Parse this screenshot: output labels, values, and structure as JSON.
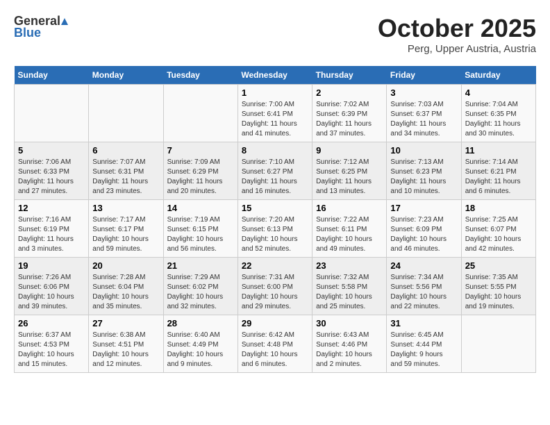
{
  "header": {
    "logo_general": "General",
    "logo_blue": "Blue",
    "month": "October 2025",
    "location": "Perg, Upper Austria, Austria"
  },
  "weekdays": [
    "Sunday",
    "Monday",
    "Tuesday",
    "Wednesday",
    "Thursday",
    "Friday",
    "Saturday"
  ],
  "weeks": [
    [
      {
        "day": "",
        "info": ""
      },
      {
        "day": "",
        "info": ""
      },
      {
        "day": "",
        "info": ""
      },
      {
        "day": "1",
        "info": "Sunrise: 7:00 AM\nSunset: 6:41 PM\nDaylight: 11 hours\nand 41 minutes."
      },
      {
        "day": "2",
        "info": "Sunrise: 7:02 AM\nSunset: 6:39 PM\nDaylight: 11 hours\nand 37 minutes."
      },
      {
        "day": "3",
        "info": "Sunrise: 7:03 AM\nSunset: 6:37 PM\nDaylight: 11 hours\nand 34 minutes."
      },
      {
        "day": "4",
        "info": "Sunrise: 7:04 AM\nSunset: 6:35 PM\nDaylight: 11 hours\nand 30 minutes."
      }
    ],
    [
      {
        "day": "5",
        "info": "Sunrise: 7:06 AM\nSunset: 6:33 PM\nDaylight: 11 hours\nand 27 minutes."
      },
      {
        "day": "6",
        "info": "Sunrise: 7:07 AM\nSunset: 6:31 PM\nDaylight: 11 hours\nand 23 minutes."
      },
      {
        "day": "7",
        "info": "Sunrise: 7:09 AM\nSunset: 6:29 PM\nDaylight: 11 hours\nand 20 minutes."
      },
      {
        "day": "8",
        "info": "Sunrise: 7:10 AM\nSunset: 6:27 PM\nDaylight: 11 hours\nand 16 minutes."
      },
      {
        "day": "9",
        "info": "Sunrise: 7:12 AM\nSunset: 6:25 PM\nDaylight: 11 hours\nand 13 minutes."
      },
      {
        "day": "10",
        "info": "Sunrise: 7:13 AM\nSunset: 6:23 PM\nDaylight: 11 hours\nand 10 minutes."
      },
      {
        "day": "11",
        "info": "Sunrise: 7:14 AM\nSunset: 6:21 PM\nDaylight: 11 hours\nand 6 minutes."
      }
    ],
    [
      {
        "day": "12",
        "info": "Sunrise: 7:16 AM\nSunset: 6:19 PM\nDaylight: 11 hours\nand 3 minutes."
      },
      {
        "day": "13",
        "info": "Sunrise: 7:17 AM\nSunset: 6:17 PM\nDaylight: 10 hours\nand 59 minutes."
      },
      {
        "day": "14",
        "info": "Sunrise: 7:19 AM\nSunset: 6:15 PM\nDaylight: 10 hours\nand 56 minutes."
      },
      {
        "day": "15",
        "info": "Sunrise: 7:20 AM\nSunset: 6:13 PM\nDaylight: 10 hours\nand 52 minutes."
      },
      {
        "day": "16",
        "info": "Sunrise: 7:22 AM\nSunset: 6:11 PM\nDaylight: 10 hours\nand 49 minutes."
      },
      {
        "day": "17",
        "info": "Sunrise: 7:23 AM\nSunset: 6:09 PM\nDaylight: 10 hours\nand 46 minutes."
      },
      {
        "day": "18",
        "info": "Sunrise: 7:25 AM\nSunset: 6:07 PM\nDaylight: 10 hours\nand 42 minutes."
      }
    ],
    [
      {
        "day": "19",
        "info": "Sunrise: 7:26 AM\nSunset: 6:06 PM\nDaylight: 10 hours\nand 39 minutes."
      },
      {
        "day": "20",
        "info": "Sunrise: 7:28 AM\nSunset: 6:04 PM\nDaylight: 10 hours\nand 35 minutes."
      },
      {
        "day": "21",
        "info": "Sunrise: 7:29 AM\nSunset: 6:02 PM\nDaylight: 10 hours\nand 32 minutes."
      },
      {
        "day": "22",
        "info": "Sunrise: 7:31 AM\nSunset: 6:00 PM\nDaylight: 10 hours\nand 29 minutes."
      },
      {
        "day": "23",
        "info": "Sunrise: 7:32 AM\nSunset: 5:58 PM\nDaylight: 10 hours\nand 25 minutes."
      },
      {
        "day": "24",
        "info": "Sunrise: 7:34 AM\nSunset: 5:56 PM\nDaylight: 10 hours\nand 22 minutes."
      },
      {
        "day": "25",
        "info": "Sunrise: 7:35 AM\nSunset: 5:55 PM\nDaylight: 10 hours\nand 19 minutes."
      }
    ],
    [
      {
        "day": "26",
        "info": "Sunrise: 6:37 AM\nSunset: 4:53 PM\nDaylight: 10 hours\nand 15 minutes."
      },
      {
        "day": "27",
        "info": "Sunrise: 6:38 AM\nSunset: 4:51 PM\nDaylight: 10 hours\nand 12 minutes."
      },
      {
        "day": "28",
        "info": "Sunrise: 6:40 AM\nSunset: 4:49 PM\nDaylight: 10 hours\nand 9 minutes."
      },
      {
        "day": "29",
        "info": "Sunrise: 6:42 AM\nSunset: 4:48 PM\nDaylight: 10 hours\nand 6 minutes."
      },
      {
        "day": "30",
        "info": "Sunrise: 6:43 AM\nSunset: 4:46 PM\nDaylight: 10 hours\nand 2 minutes."
      },
      {
        "day": "31",
        "info": "Sunrise: 6:45 AM\nSunset: 4:44 PM\nDaylight: 9 hours\nand 59 minutes."
      },
      {
        "day": "",
        "info": ""
      }
    ]
  ]
}
